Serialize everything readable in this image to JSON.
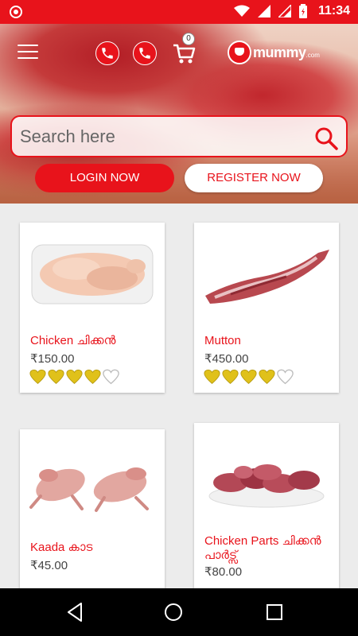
{
  "status_bar": {
    "time": "11:34"
  },
  "header": {
    "cart_count": "0",
    "logo_text": "mummy",
    "logo_domain": ".com"
  },
  "search": {
    "placeholder": "Search here"
  },
  "auth": {
    "login_label": "LOGIN NOW",
    "register_label": "REGISTER NOW"
  },
  "products": [
    {
      "name": "Chicken ചിക്കൻ",
      "price": "₹150.00",
      "rating": 4,
      "max_rating": 5
    },
    {
      "name": "Mutton",
      "price": "₹450.00",
      "rating": 4,
      "max_rating": 5
    },
    {
      "name": "Kaada കാട",
      "price": "₹45.00"
    },
    {
      "name": "Chicken Parts ചിക്കൻ പാർട്സ്",
      "price": "₹80.00"
    }
  ],
  "colors": {
    "brand": "#e8131b",
    "heart_filled": "#e0c11a",
    "heart_empty": "#bbbbbb"
  },
  "icons": [
    "menu-icon",
    "phone-icon",
    "cart-icon",
    "search-icon",
    "heart-icon",
    "back-icon",
    "home-icon",
    "recents-icon"
  ]
}
